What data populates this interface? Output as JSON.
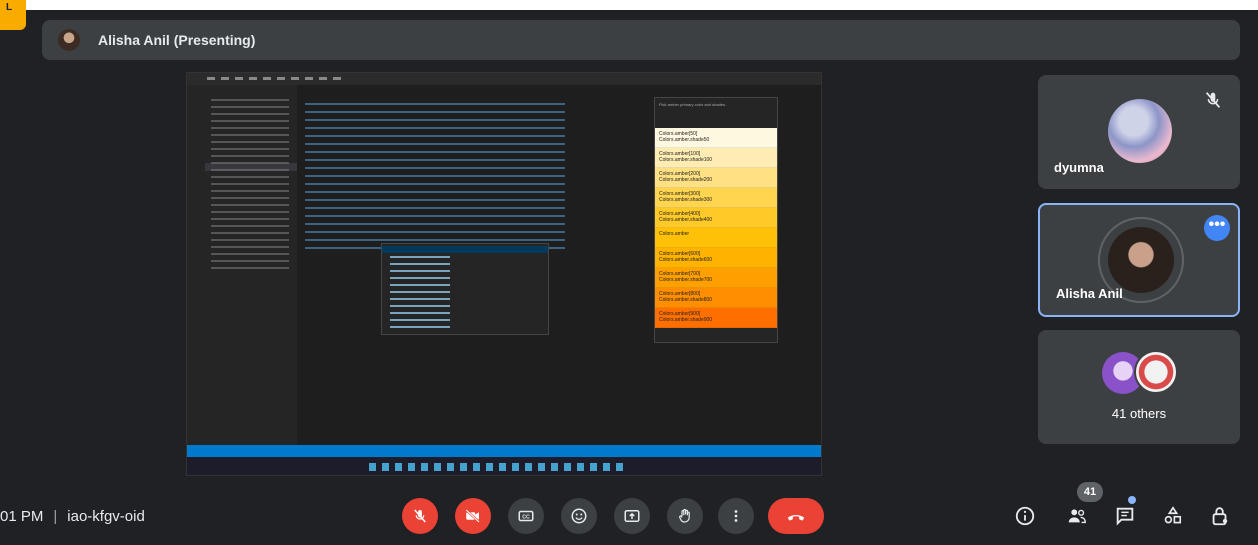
{
  "corner_badge": "L",
  "presenter": {
    "name": "Alisha Anil (Presenting)"
  },
  "shared_screen": {
    "color_hint": "Pick amber primary color and shades.",
    "swatches": [
      {
        "line1": "Colors.amber[50]",
        "line2": "Colors.amber.shade50",
        "color": "#fff8e1"
      },
      {
        "line1": "Colors.amber[100]",
        "line2": "Colors.amber.shade100",
        "color": "#ffecb3"
      },
      {
        "line1": "Colors.amber[200]",
        "line2": "Colors.amber.shade200",
        "color": "#ffe082"
      },
      {
        "line1": "Colors.amber[300]",
        "line2": "Colors.amber.shade300",
        "color": "#ffd54f"
      },
      {
        "line1": "Colors.amber[400]",
        "line2": "Colors.amber.shade400",
        "color": "#ffca28"
      },
      {
        "line1": "Colors.amber",
        "line2": "",
        "color": "#ffc107"
      },
      {
        "line1": "Colors.amber[600]",
        "line2": "Colors.amber.shade600",
        "color": "#ffb300"
      },
      {
        "line1": "Colors.amber[700]",
        "line2": "Colors.amber.shade700",
        "color": "#ffa000"
      },
      {
        "line1": "Colors.amber[800]",
        "line2": "Colors.amber.shade800",
        "color": "#ff8f00"
      },
      {
        "line1": "Colors.amber[900]",
        "line2": "Colors.amber.shade900",
        "color": "#ff6f00"
      }
    ]
  },
  "participants": {
    "tiles": [
      {
        "name": "dyumna",
        "muted": true
      },
      {
        "name": "Alisha Anil",
        "active": true
      },
      {
        "name": "41 others"
      }
    ]
  },
  "meeting": {
    "time": "01 PM",
    "code": "iao-kfgv-oid"
  },
  "people_count": "41",
  "colors": {
    "danger": "#ea4335",
    "accent": "#8ab4f8",
    "surface": "#3c4043",
    "background": "#202124"
  },
  "controls": [
    "mic-off-icon",
    "camera-off-icon",
    "captions-icon",
    "emoji-icon",
    "present-icon",
    "raise-hand-icon",
    "more-options-icon",
    "end-call-icon"
  ],
  "right_controls": [
    "info-icon",
    "people-icon",
    "chat-icon",
    "activities-icon",
    "host-controls-icon"
  ]
}
